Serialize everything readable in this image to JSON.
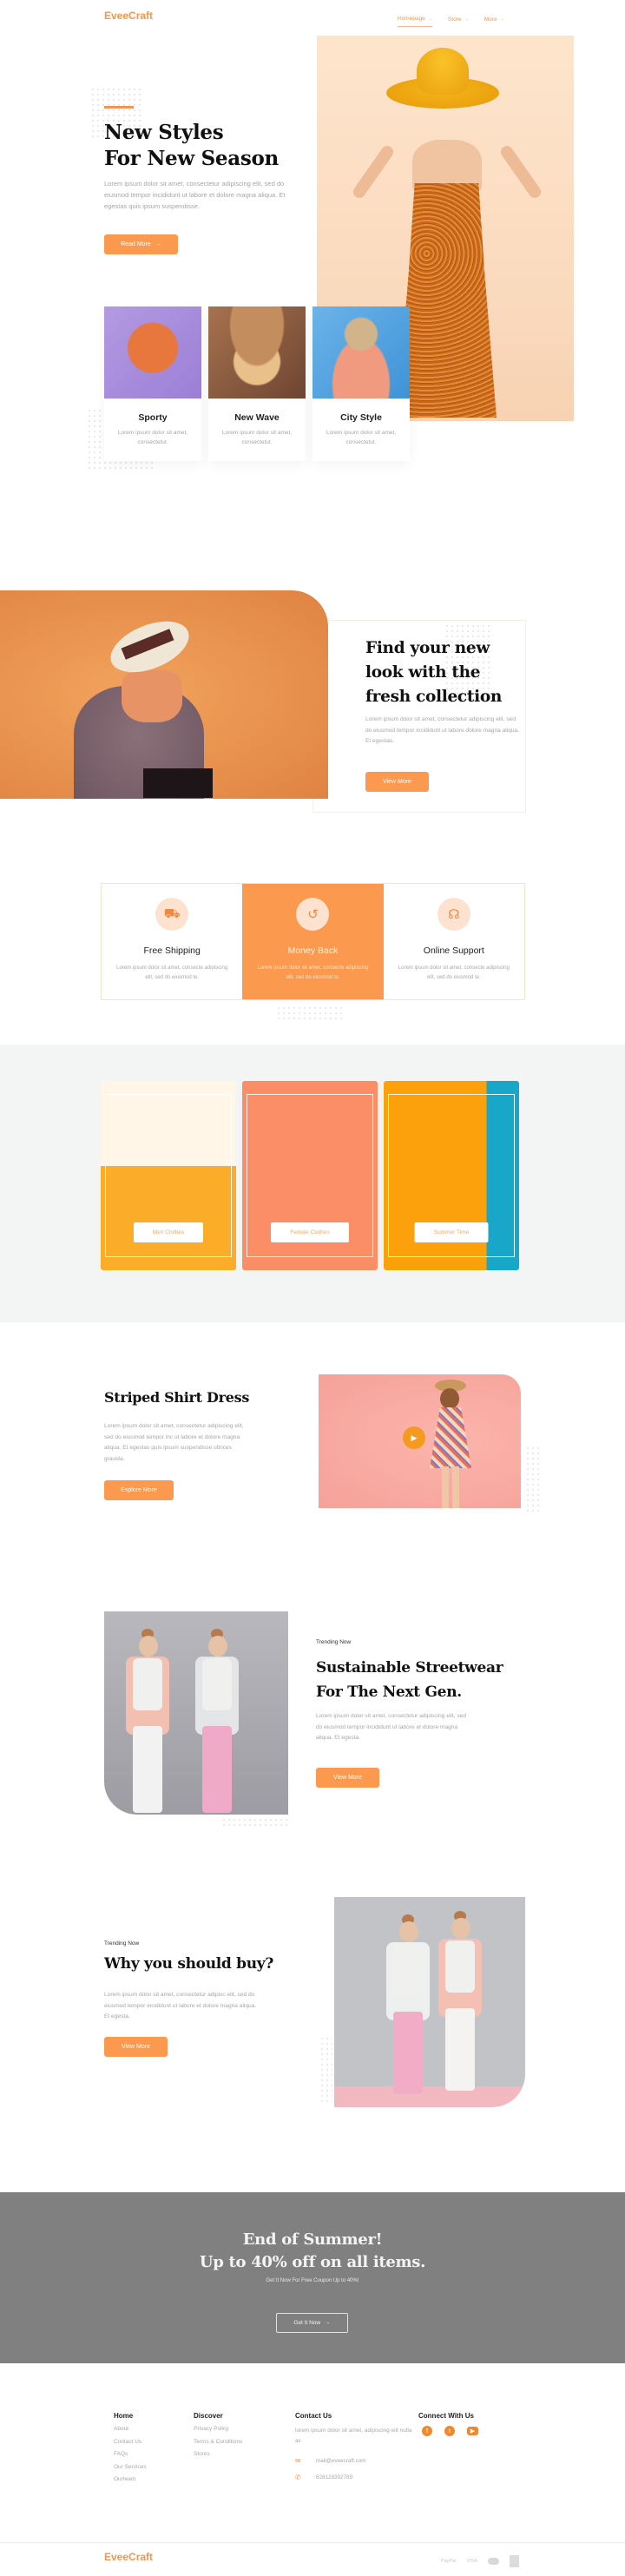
{
  "header": {
    "logo": "EveeCraft",
    "nav": [
      {
        "label": "Homepage",
        "active": true
      },
      {
        "label": "Store",
        "active": false
      },
      {
        "label": "More",
        "active": false
      }
    ],
    "chevron": "⌄"
  },
  "hero": {
    "title_line1": "New Styles",
    "title_line2": "For New Season",
    "text": "Lorem ipsum dolor sit amet, consectetur adipiscing elit, sed do eiusmod tempor incididunt ut labore et dolore magna aliqua. Et egestas quis ipsum suspendisse.",
    "button": "Read More",
    "arrow": "→"
  },
  "styles": [
    {
      "title": "Sporty",
      "text": "Lorem ipsum dolor sit amet, consectetur."
    },
    {
      "title": "New Wave",
      "text": "Lorem ipsum dolor sit amet, consectetur."
    },
    {
      "title": "City Style",
      "text": "Lorem ipsum dolor sit amet, consectetur."
    }
  ],
  "look": {
    "title": "Find your new look with the fresh collection",
    "text": "Lorem ipsum dolor sit amet, consectetur adipiscing elit, sed do eiusmod tempor incididunt ut labore dolore magna aliqua. Et egestas.",
    "button": "View More"
  },
  "features": [
    {
      "icon": "⛟",
      "title": "Free Shipping",
      "text": "Lorem ipsum dolor sit amet, consecte adipiscing elit, sed do eiusmod te."
    },
    {
      "icon": "↺",
      "title": "Money Back",
      "text": "Lorem ipsum dolor sit amet, consecte adipiscing elit, sed do eiusmod te."
    },
    {
      "icon": "☊",
      "title": "Online Support",
      "text": "Lorem ipsum dolor sit amet, consecte adipiscing elit, sed do eiusmod te."
    }
  ],
  "categories": [
    {
      "label": "Men Clothes"
    },
    {
      "label": "Female Clothes"
    },
    {
      "label": "Summer Time"
    }
  ],
  "striped": {
    "title": "Striped Shirt Dress",
    "text": "Lorem ipsum dolor sit amet, consectetur adipiscing elit, sed do eiusmod tempor inc ut labore et dolore magna aliqua. Et egestas quis ipsum suspendisse ultrices gravida.",
    "button": "Explore More",
    "play": "▶"
  },
  "streetwear": {
    "tag": "Trending Now",
    "title_line1": "Sustainable Streetwear",
    "title_line2": "For The Next Gen.",
    "text": "Lorem ipsum dolor sit amet, consectetur adipiscing elit, sed do eiusmod tempor incididunt ut labore et dolore magna aliqua. Et egesta.",
    "button": "View More"
  },
  "whybuy": {
    "tag": "Trending Now",
    "title": "Why you should buy?",
    "text": "Lorem ipsum dolor sit amet, consectetur adipisc elit, sed do eiusmod tempor incididunt ut labore et dolore magna aliqua. Et egesta.",
    "button": "View More"
  },
  "promo": {
    "title_line1": "End of Summer!",
    "title_line2": "Up to 40% off on all items.",
    "subtitle": "Get It Now For Free Coupon Up to 40%!",
    "button": "Get It Now",
    "arrow": "→"
  },
  "footer": {
    "home": {
      "heading": "Home",
      "links": [
        "About",
        "Contact Us",
        "FAQs",
        "Our Services",
        "Ourteam"
      ]
    },
    "discover": {
      "heading": "Discover",
      "links": [
        "Privacy Policy",
        "Terms & Conditions",
        "Stores"
      ]
    },
    "contact": {
      "heading": "Contact Us",
      "text": "lorem ipsum dolor sit amet, adipiscing elit nulla ac",
      "email": "mail@eveecraft.com",
      "phone": "628128392789"
    },
    "connect": {
      "heading": "Connect With Us",
      "facebook": "f",
      "twitter": "t",
      "youtube": "▶"
    },
    "logo": "EveeCraft",
    "payments": {
      "paypal": "PayPal",
      "visa": "VISA"
    }
  },
  "colors": {
    "accent": "#fb9a4e",
    "logo": "#f2964f",
    "promo_bg": "#808080"
  }
}
